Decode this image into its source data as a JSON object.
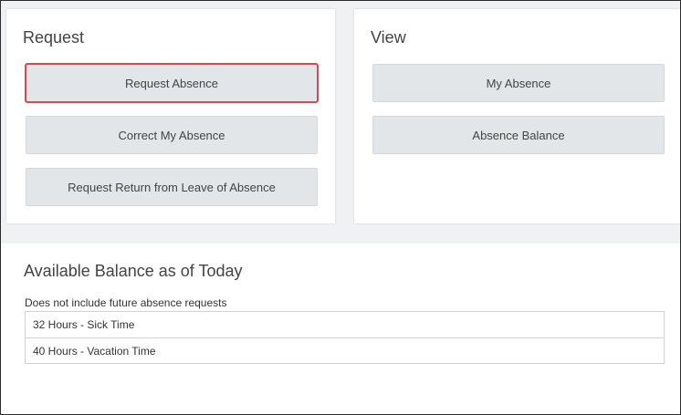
{
  "request": {
    "title": "Request",
    "buttons": [
      {
        "label": "Request Absence",
        "highlighted": true
      },
      {
        "label": "Correct My Absence"
      },
      {
        "label": "Request Return from Leave of Absence"
      }
    ]
  },
  "view": {
    "title": "View",
    "buttons": [
      {
        "label": "My Absence"
      },
      {
        "label": "Absence Balance"
      }
    ]
  },
  "balance": {
    "title": "Available Balance as of Today",
    "note": "Does not include future absence requests",
    "rows": [
      {
        "text": "32 Hours - Sick Time"
      },
      {
        "text": "40 Hours - Vacation Time"
      }
    ]
  },
  "colors": {
    "button_bg": "#e2e6e8",
    "highlight": "#e0474c",
    "page_bg": "#f0f1f2"
  }
}
